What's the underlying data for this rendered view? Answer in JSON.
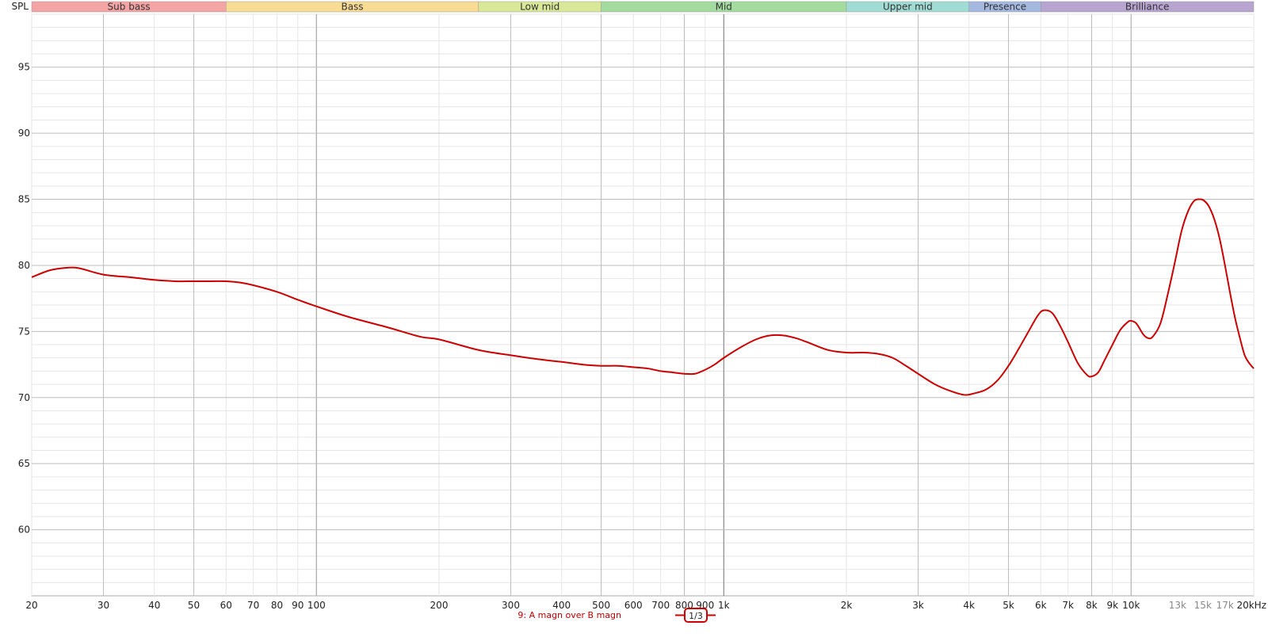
{
  "chart_data": {
    "type": "line",
    "title": "",
    "ylabel": "SPL",
    "x_unit": "kHz",
    "x_scale": "log",
    "xlim": [
      20,
      20000
    ],
    "ylim": [
      55,
      99
    ],
    "grid": true,
    "bands": [
      {
        "name": "Sub bass",
        "from": 20,
        "to": 60,
        "color": "#f4a4a4"
      },
      {
        "name": "Bass",
        "from": 60,
        "to": 250,
        "color": "#f8dc94"
      },
      {
        "name": "Low mid",
        "from": 250,
        "to": 500,
        "color": "#d8e898"
      },
      {
        "name": "Mid",
        "from": 500,
        "to": 2000,
        "color": "#a4dca0"
      },
      {
        "name": "Upper mid",
        "from": 2000,
        "to": 4000,
        "color": "#a0dcd4"
      },
      {
        "name": "Presence",
        "from": 4000,
        "to": 6000,
        "color": "#a4b8e0"
      },
      {
        "name": "Brilliance",
        "from": 6000,
        "to": 20000,
        "color": "#b8a4d0"
      }
    ],
    "x_ticks": [
      {
        "v": 20,
        "label": "20",
        "minor": false
      },
      {
        "v": 30,
        "label": "30",
        "minor": false
      },
      {
        "v": 40,
        "label": "40",
        "minor": false
      },
      {
        "v": 50,
        "label": "50",
        "minor": false
      },
      {
        "v": 60,
        "label": "60",
        "minor": false
      },
      {
        "v": 70,
        "label": "70",
        "minor": false
      },
      {
        "v": 80,
        "label": "80",
        "minor": false
      },
      {
        "v": 90,
        "label": "90",
        "minor": false
      },
      {
        "v": 100,
        "label": "100",
        "minor": false
      },
      {
        "v": 200,
        "label": "200",
        "minor": false
      },
      {
        "v": 300,
        "label": "300",
        "minor": false
      },
      {
        "v": 400,
        "label": "400",
        "minor": false
      },
      {
        "v": 500,
        "label": "500",
        "minor": false
      },
      {
        "v": 600,
        "label": "600",
        "minor": false
      },
      {
        "v": 700,
        "label": "700",
        "minor": false
      },
      {
        "v": 800,
        "label": "800",
        "minor": false
      },
      {
        "v": 900,
        "label": "900",
        "minor": false
      },
      {
        "v": 1000,
        "label": "1k",
        "minor": false
      },
      {
        "v": 2000,
        "label": "2k",
        "minor": false
      },
      {
        "v": 3000,
        "label": "3k",
        "minor": false
      },
      {
        "v": 4000,
        "label": "4k",
        "minor": false
      },
      {
        "v": 5000,
        "label": "5k",
        "minor": false
      },
      {
        "v": 6000,
        "label": "6k",
        "minor": false
      },
      {
        "v": 7000,
        "label": "7k",
        "minor": false
      },
      {
        "v": 8000,
        "label": "8k",
        "minor": false
      },
      {
        "v": 9000,
        "label": "9k",
        "minor": false
      },
      {
        "v": 10000,
        "label": "10k",
        "minor": false
      },
      {
        "v": 13000,
        "label": "13k",
        "minor": true
      },
      {
        "v": 15000,
        "label": "15k",
        "minor": true
      },
      {
        "v": 17000,
        "label": "17k",
        "minor": true
      },
      {
        "v": 20000,
        "label": "20kHz",
        "minor": false
      }
    ],
    "y_ticks": [
      60,
      65,
      70,
      75,
      80,
      85,
      90,
      95
    ],
    "series": [
      {
        "name": "9: A magn over B magn",
        "color": "#cc0000",
        "x": [
          20,
          22,
          24,
          26,
          30,
          35,
          40,
          45,
          50,
          55,
          60,
          65,
          70,
          80,
          90,
          100,
          120,
          150,
          180,
          200,
          250,
          300,
          350,
          400,
          450,
          500,
          550,
          600,
          650,
          700,
          750,
          800,
          850,
          900,
          950,
          1000,
          1100,
          1200,
          1300,
          1400,
          1500,
          1600,
          1800,
          2000,
          2200,
          2400,
          2600,
          2800,
          3000,
          3300,
          3600,
          3900,
          4100,
          4400,
          4700,
          5000,
          5300,
          5600,
          5900,
          6100,
          6400,
          6700,
          7000,
          7400,
          7800,
          8000,
          8300,
          8600,
          9000,
          9400,
          9800,
          10000,
          10300,
          10700,
          11000,
          11300,
          11800,
          12300,
          12800,
          13300,
          13800,
          14300,
          14800,
          15100,
          15500,
          16000,
          16500,
          17000,
          17500,
          18000,
          18500,
          19000,
          19500,
          20000
        ],
        "y": [
          79.1,
          79.6,
          79.8,
          79.8,
          79.3,
          79.1,
          78.9,
          78.8,
          78.8,
          78.8,
          78.8,
          78.7,
          78.5,
          78.0,
          77.4,
          76.9,
          76.1,
          75.3,
          74.6,
          74.4,
          73.6,
          73.2,
          72.9,
          72.7,
          72.5,
          72.4,
          72.4,
          72.3,
          72.2,
          72.0,
          71.9,
          71.8,
          71.8,
          72.1,
          72.5,
          73.0,
          73.8,
          74.4,
          74.7,
          74.7,
          74.5,
          74.2,
          73.6,
          73.4,
          73.4,
          73.3,
          73.0,
          72.4,
          71.8,
          71.0,
          70.5,
          70.2,
          70.3,
          70.6,
          71.3,
          72.4,
          73.7,
          75.0,
          76.2,
          76.6,
          76.4,
          75.4,
          74.2,
          72.6,
          71.7,
          71.6,
          71.9,
          72.8,
          74.0,
          75.1,
          75.7,
          75.8,
          75.6,
          74.8,
          74.5,
          74.6,
          75.6,
          77.8,
          80.2,
          82.6,
          84.1,
          84.9,
          85.0,
          84.9,
          84.5,
          83.5,
          82.0,
          80.0,
          77.9,
          76.0,
          74.5,
          73.2,
          72.6,
          72.2
        ]
      }
    ],
    "smoothing": "1/3"
  }
}
